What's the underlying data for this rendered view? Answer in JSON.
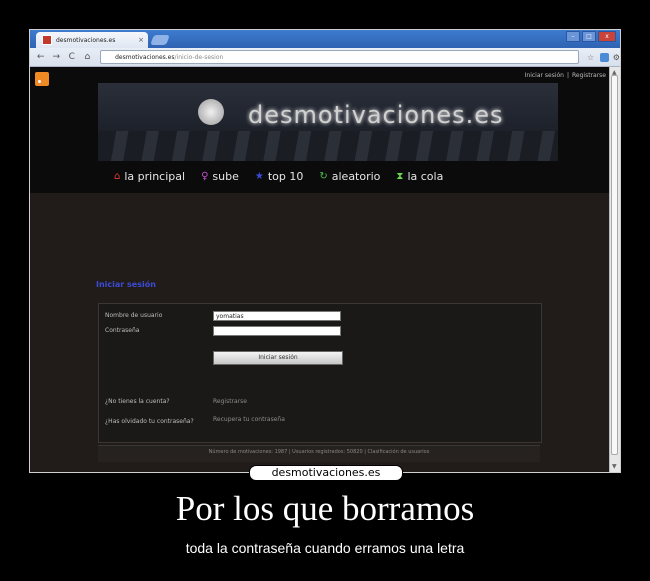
{
  "browser": {
    "tab_title": "desmotivaciones.es",
    "tab_close": "×",
    "url_host": "desmotivaciones.es",
    "url_path": "/inicio-de-sesion",
    "back": "←",
    "forward": "→",
    "reload": "C",
    "home": "⌂",
    "star": "☆",
    "wrench": "⚙",
    "min": "–",
    "max": "□",
    "close": "x"
  },
  "site": {
    "auth_login": "Iniciar sesión",
    "auth_sep": "|",
    "auth_register": "Registrarse",
    "logo_text": "desmotivaciones.es",
    "nav": [
      {
        "icon": "⌂",
        "label": "la principal",
        "color": "#e23d3d"
      },
      {
        "icon": "♀",
        "label": "sube",
        "color": "#c04fd0"
      },
      {
        "icon": "★",
        "label": "top 10",
        "color": "#3a4bd8"
      },
      {
        "icon": "↻",
        "label": "aleatorio",
        "color": "#4fbf4f"
      },
      {
        "icon": "⧗",
        "label": "la cola",
        "color": "#6bd84a"
      }
    ]
  },
  "login": {
    "title": "Iniciar sesión",
    "username_label": "Nombre de usuario",
    "username_value": "yomatias",
    "password_label": "Contraseña",
    "password_value": "",
    "submit_label": "Iniciar sesión",
    "no_account_label": "¿No tienes la cuenta?",
    "register_link": "Registrarse",
    "forgot_label": "¿Has olvidado tu contraseña?",
    "recover_link": "Recupera tu contraseña"
  },
  "footer": {
    "text": "Número de motivaciones: 1987 | Usuarios registrados: 50820 | Clasificación de usuarios"
  },
  "poster": {
    "watermark": "desmotivaciones.es",
    "title": "Por los que borramos",
    "subtitle": "toda la contraseña cuando erramos una letra"
  }
}
